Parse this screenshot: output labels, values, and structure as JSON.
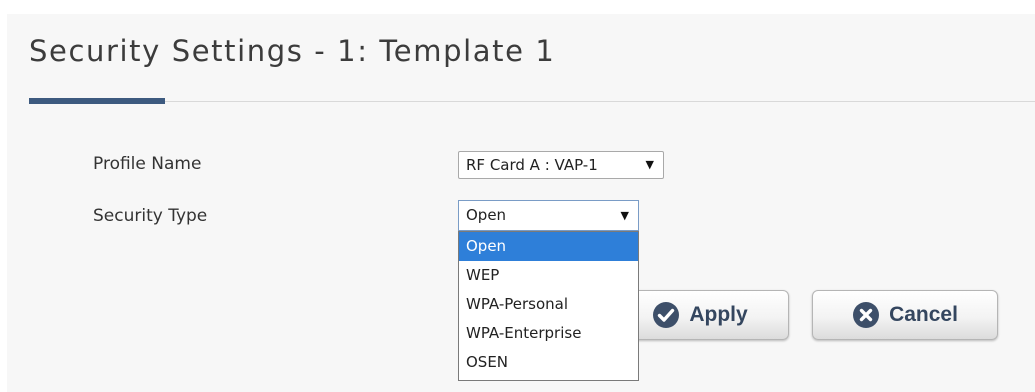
{
  "page": {
    "title": "Security Settings - 1: Template 1"
  },
  "form": {
    "profile_name": {
      "label": "Profile Name",
      "value": "RF Card A : VAP-1"
    },
    "security_type": {
      "label": "Security Type",
      "value": "Open",
      "options": [
        "Open",
        "WEP",
        "WPA-Personal",
        "WPA-Enterprise",
        "OSEN"
      ],
      "highlighted": "Open"
    }
  },
  "actions": {
    "apply_label": "Apply",
    "apply_icon": "check-icon",
    "cancel_label": "Cancel",
    "cancel_icon": "close-icon"
  },
  "colors": {
    "accent": "#3d5a7f",
    "option_highlight": "#2e7fd9",
    "button_text": "#34465f"
  }
}
